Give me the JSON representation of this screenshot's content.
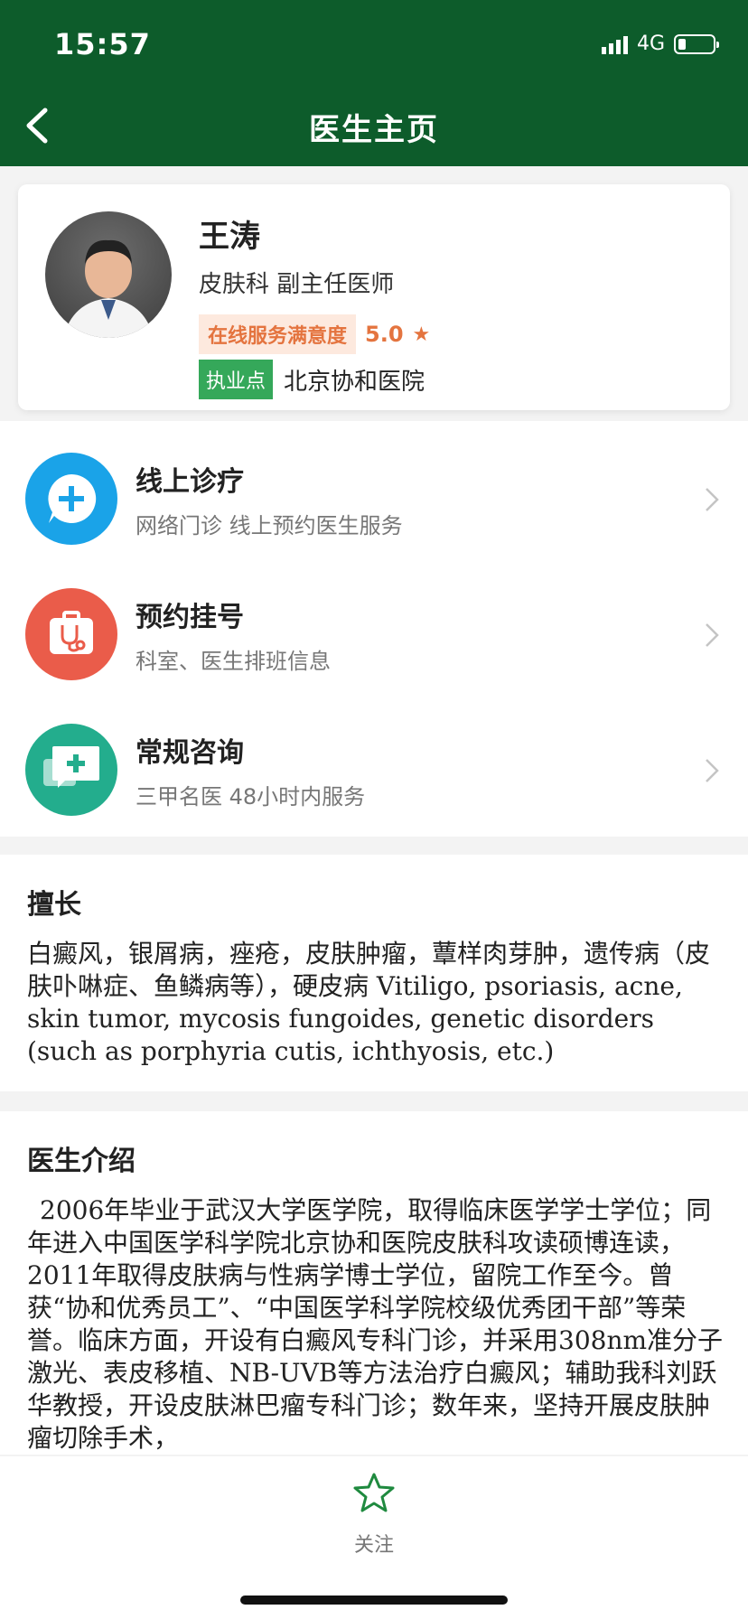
{
  "status_bar": {
    "time": "15:57",
    "network": "4G"
  },
  "header": {
    "title": "医生主页"
  },
  "doctor": {
    "name": "王涛",
    "department_title": "皮肤科 副主任医师",
    "satisfaction_label": "在线服务满意度",
    "satisfaction_score": "5.0",
    "location_tag": "执业点",
    "hospital": "北京协和医院"
  },
  "services": [
    {
      "title": "线上诊疗",
      "subtitle": "网络门诊 线上预约医生服务",
      "icon": "plus-chat-icon",
      "color": "#1aa3e8"
    },
    {
      "title": "预约挂号",
      "subtitle": "科室、医生排班信息",
      "icon": "stethoscope-icon",
      "color": "#ea5c4a"
    },
    {
      "title": "常规咨询",
      "subtitle": "三甲名医 48小时内服务",
      "icon": "consult-icon",
      "color": "#23ad8d"
    }
  ],
  "expertise": {
    "title": "擅长",
    "text": "白癜风，银屑病，痤疮，皮肤肿瘤，蕈样肉芽肿，遗传病（皮肤卟啉症、鱼鳞病等），硬皮病 Vitiligo, psoriasis, acne, skin tumor, mycosis fungoides, genetic disorders (such as porphyria cutis, ichthyosis, etc.)"
  },
  "intro": {
    "title": "医生介绍",
    "text": "2006年毕业于武汉大学医学院，取得临床医学学士学位；同年进入中国医学科学院北京协和医院皮肤科攻读硕博连读，2011年取得皮肤病与性病学博士学位，留院工作至今。曾获“协和优秀员工”、“中国医学科学院校级优秀团干部”等荣誉。临床方面，开设有白癜风专科门诊，并采用308nm准分子激光、表皮移植、NB-UVB等方法治疗白癜风；辅助我科刘跃华教授，开设皮肤淋巴瘤专科门诊；数年来，坚持开展皮肤肿瘤切除手术，"
  },
  "bottom": {
    "follow_label": "关注"
  }
}
